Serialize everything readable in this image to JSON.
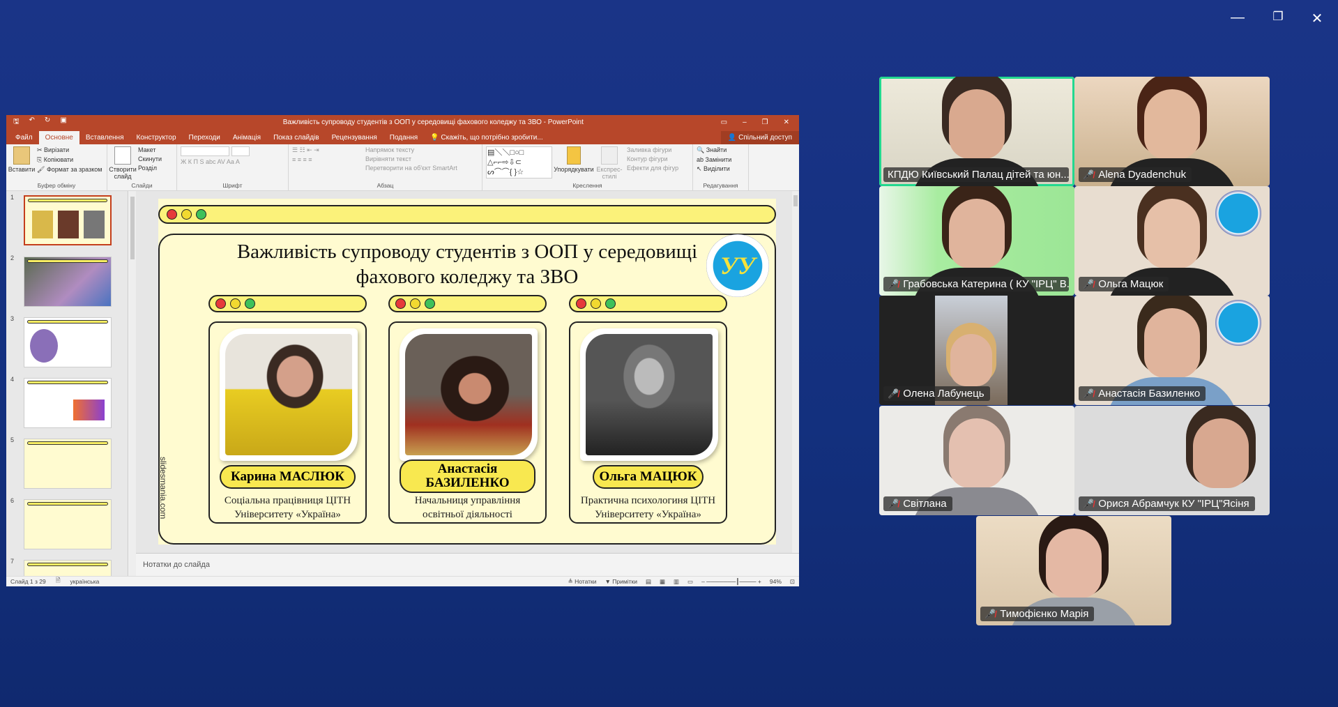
{
  "window_controls": {
    "minimize": "—",
    "restore": "❐",
    "close": "✕"
  },
  "ppt": {
    "title": "Важливість супроводу студентів з ООП у середовищі фахового коледжу та ЗВО - PowerPoint",
    "tabs": [
      "Файл",
      "Основне",
      "Вставлення",
      "Конструктор",
      "Переходи",
      "Анімація",
      "Показ слайдів",
      "Рецензування",
      "Подання"
    ],
    "tell_me": "Скажіть, що потрібно зробити...",
    "share": "Спільний доступ",
    "ribbon": {
      "clipboard": {
        "paste": "Вставити",
        "cut": "Вирізати",
        "copy": "Копіювати",
        "format": "Формат за зразком",
        "label": "Буфер обміну"
      },
      "slides": {
        "new": "Створити слайд",
        "layout": "Макет",
        "reset": "Скинути",
        "section": "Розділ",
        "label": "Слайди"
      },
      "font": {
        "label": "Шрифт",
        "buttons": "Ж К П S abc AV Aa A"
      },
      "paragraph": {
        "dir": "Напрямок тексту",
        "align": "Вирівняти текст",
        "smartart": "Перетворити на об'єкт SmartArt",
        "label": "Абзац"
      },
      "drawing": {
        "arrange": "Упорядкувати",
        "styles": "Експрес-стилі",
        "fill": "Заливка фігури",
        "outline": "Контур фігури",
        "effects": "Ефекти для фігур",
        "label": "Креслення"
      },
      "editing": {
        "find": "Знайти",
        "replace": "Замінити",
        "select": "Виділити",
        "label": "Редагування"
      }
    },
    "thumb_numbers": [
      "1",
      "2",
      "3",
      "4",
      "5",
      "6",
      "7"
    ],
    "slide": {
      "title": "Важливість супроводу студентів з ООП у середовищі фахового коледжу та ЗВО",
      "logo": "УУ",
      "watermark": "slidesmania.com",
      "people": [
        {
          "name": "Карина МАСЛЮК",
          "desc": "Соціальна працівниця ЦІТН Університету «Україна»"
        },
        {
          "name": "Анастасія БАЗИЛЕНКО",
          "desc": "Начальниця управління освітньої діяльності"
        },
        {
          "name": "Ольга МАЦЮК",
          "desc": "Практична психологиня ЦІТН Університету «Україна»"
        }
      ]
    },
    "notes_placeholder": "Нотатки до слайда",
    "status": {
      "slide": "Слайд 1 з 29",
      "lang": "українська",
      "notes": "Нотатки",
      "comments": "Примітки",
      "zoom": "94%"
    }
  },
  "participants": [
    {
      "name": "КПДЮ Київський Палац дітей та юн...",
      "muted": false,
      "speaking": true
    },
    {
      "name": "Alena Dyadenchuk",
      "muted": true
    },
    {
      "name": "Грабовська Катерина ( КУ \"ІРЦ\" В...",
      "muted": true
    },
    {
      "name": "Ольга Мацюк",
      "muted": true
    },
    {
      "name": "Олена Лабунець",
      "muted": true
    },
    {
      "name": "Анастасія Базиленко",
      "muted": true
    },
    {
      "name": "Світлана",
      "muted": true
    },
    {
      "name": "Орися Абрамчук КУ \"ІРЦ\"Ясіня",
      "muted": true
    },
    {
      "name": "Тимофієнко Марія",
      "muted": true
    }
  ]
}
